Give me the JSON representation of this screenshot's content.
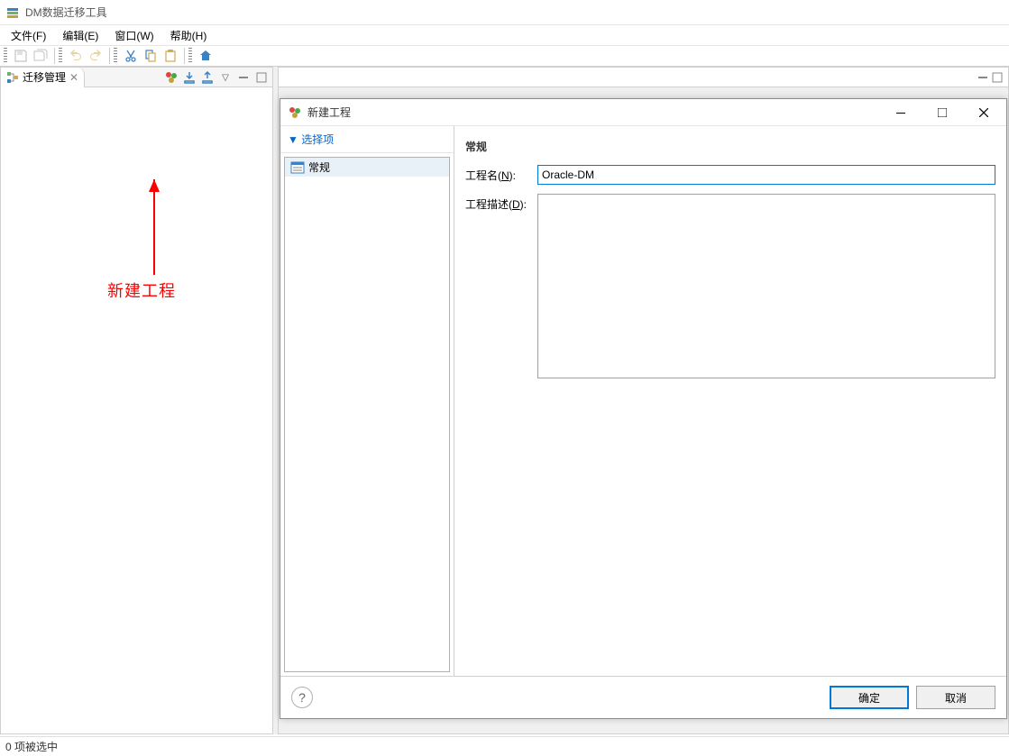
{
  "app": {
    "title": "DM数据迁移工具"
  },
  "menubar": {
    "file": "文件(F)",
    "edit": "编辑(E)",
    "window": "窗口(W)",
    "help": "帮助(H)"
  },
  "sidebar": {
    "tab_label": "迁移管理"
  },
  "annotation": {
    "text": "新建工程"
  },
  "dialog": {
    "title": "新建工程",
    "nav_header": "▼ 选择项",
    "nav_item": "常规",
    "form": {
      "header": "常规",
      "name_label_pre": "工程名(",
      "name_label_key": "N",
      "name_label_post": "):",
      "name_value": "Oracle-DM",
      "desc_label_pre": "工程描述(",
      "desc_label_key": "D",
      "desc_label_post": "):",
      "desc_value": ""
    },
    "ok_label": "确定",
    "cancel_label": "取消"
  },
  "statusbar": {
    "text": "0 项被选中"
  }
}
